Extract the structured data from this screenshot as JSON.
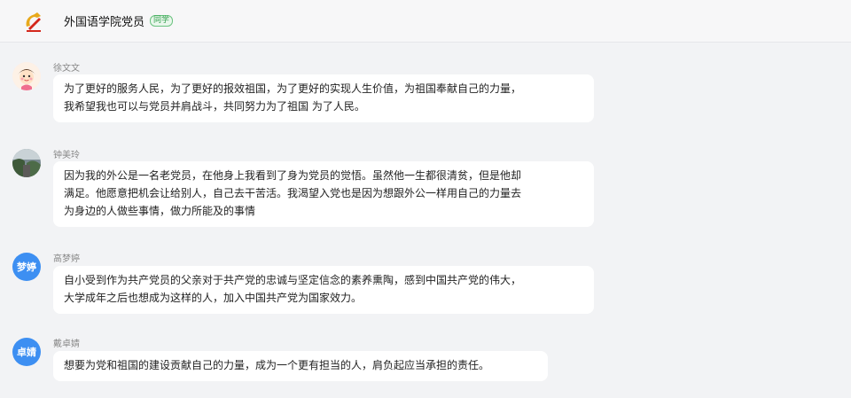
{
  "header": {
    "title": "外国语学院党员",
    "badge": "同学",
    "logo_icon": "party-emblem-icon"
  },
  "messages": [
    {
      "sender": "徐文文",
      "avatar": "cartoon-girl-avatar",
      "text": "为了更好的服务人民，为了更好的报效祖国，为了更好的实现人生价值，为祖国奉献自己的力量，\n我希望我也可以与党员并肩战斗，共同努力为了祖国 为了人民。"
    },
    {
      "sender": "钟美玲",
      "avatar": "photo-avatar",
      "text": "因为我的外公是一名老党员，在他身上我看到了身为党员的觉悟。虽然他一生都很清贫，但是他却\n满足。他愿意把机会让给别人，自己去干苦活。我渴望入党也是因为想跟外公一样用自己的力量去\n为身边的人做些事情，做力所能及的事情"
    },
    {
      "sender": "高梦婷",
      "avatar_text": "梦婷",
      "text": "自小受到作为共产党员的父亲对于共产党的忠诚与坚定信念的素养熏陶，感到中国共产党的伟大，\n大学成年之后也想成为这样的人，加入中国共产党为国家效力。"
    },
    {
      "sender": "戴卓婧",
      "avatar_text": "卓婧",
      "text": "想要为党和祖国的建设贡献自己的力量，成为一个更有担当的人，肩负起应当承担的责任。"
    }
  ],
  "colors": {
    "avatar_blue": "#3d8ff2",
    "badge_green": "#2e9e4a"
  }
}
